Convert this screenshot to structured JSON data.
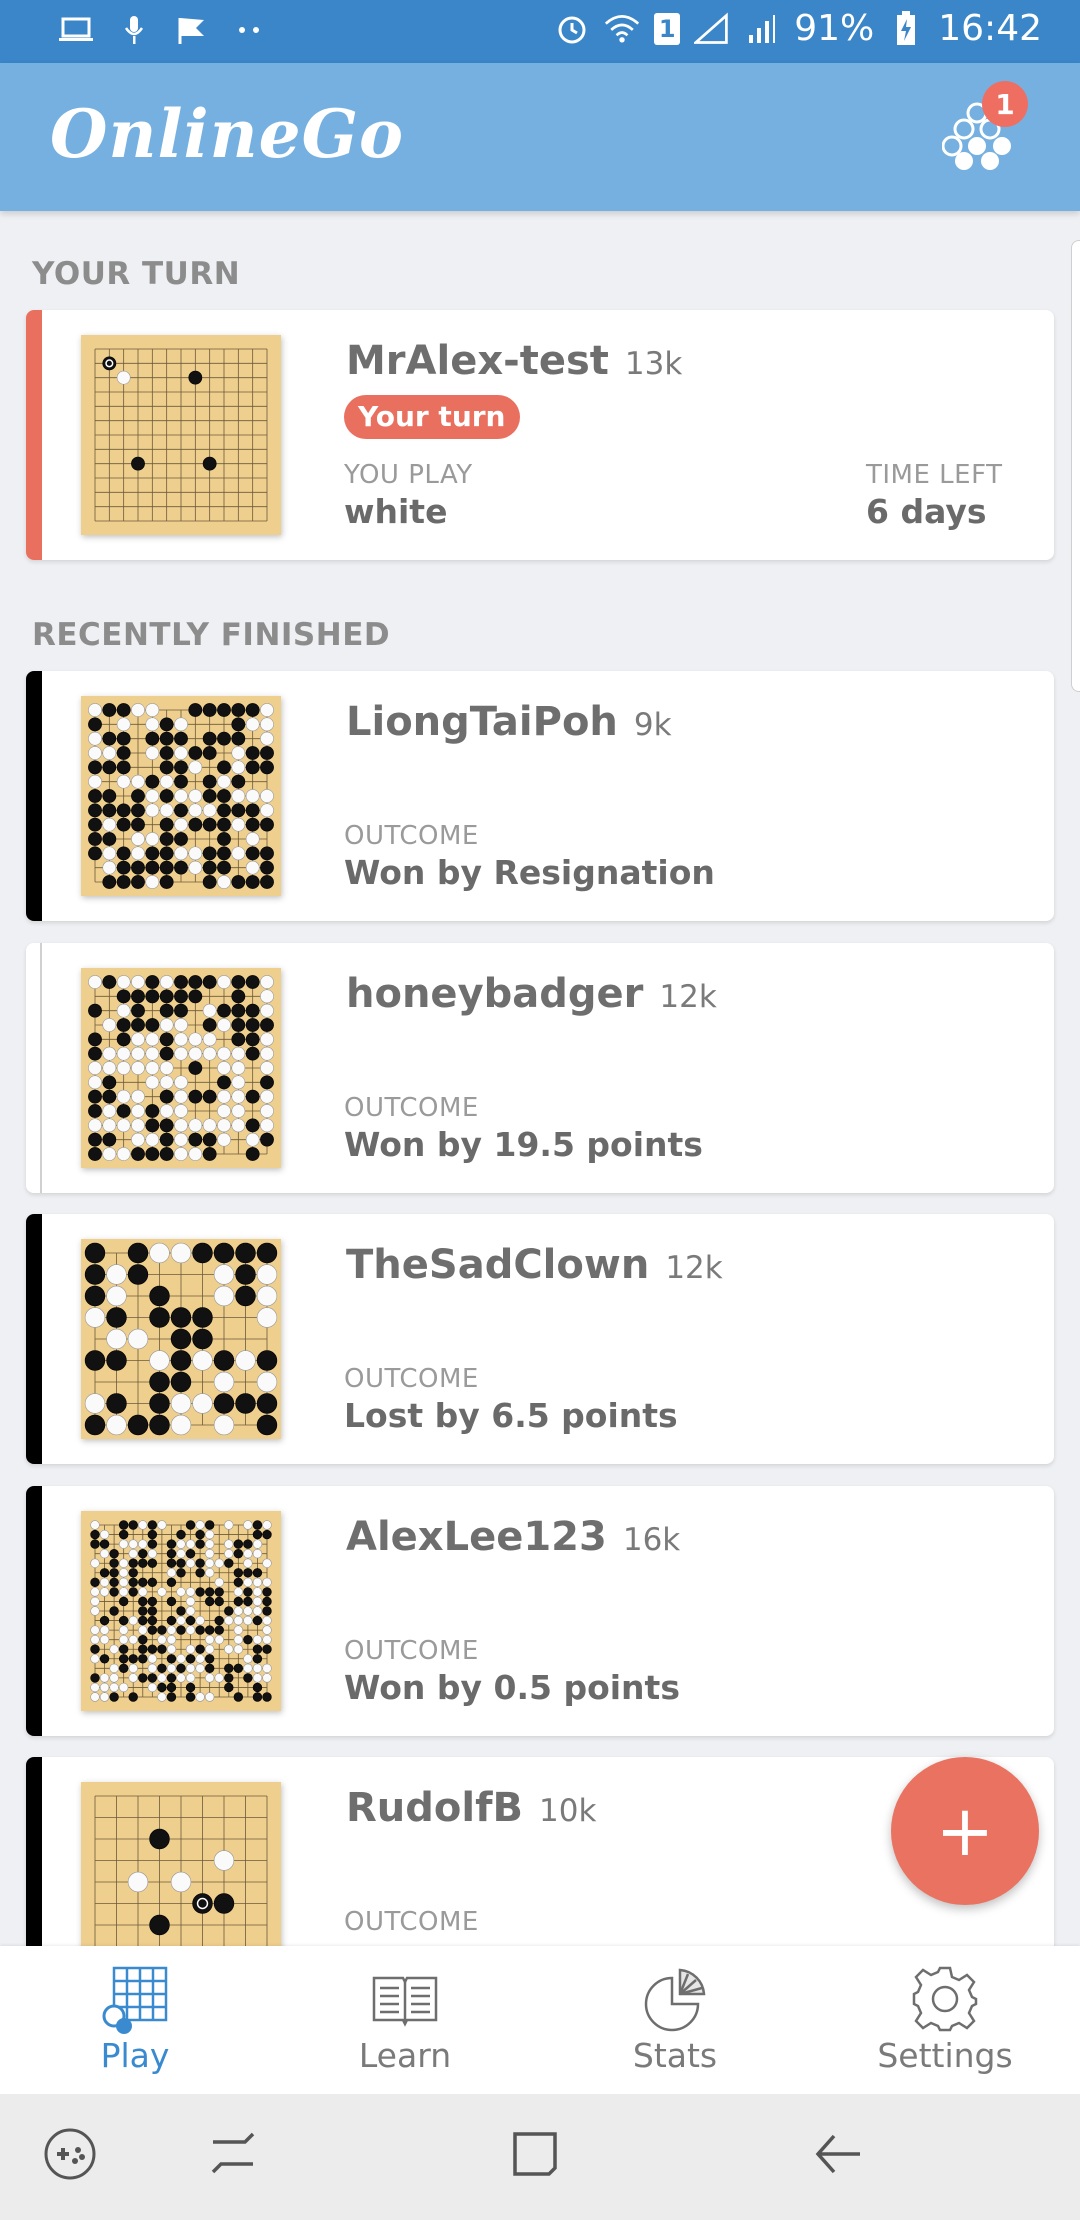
{
  "status_bar": {
    "battery": "91%",
    "time": "16:42",
    "sim_badge": "1"
  },
  "app": {
    "title": "OnlineGo",
    "notification_count": "1"
  },
  "sections": {
    "your_turn": "YOUR TURN",
    "recently_finished": "RECENTLY FINISHED"
  },
  "your_turn_game": {
    "opponent": "MrAlex-test",
    "rank": "13k",
    "badge": "Your turn",
    "you_play_label": "YOU PLAY",
    "you_play_value": "white",
    "time_left_label": "TIME LEFT",
    "time_left_value": "6 days",
    "stripe_color": "#e9705f"
  },
  "finished_games": [
    {
      "opponent": "LiongTaiPoh",
      "rank": "9k",
      "outcome_label": "OUTCOME",
      "outcome": "Won by Resignation",
      "stripe_color": "#000000"
    },
    {
      "opponent": "honeybadger",
      "rank": "12k",
      "outcome_label": "OUTCOME",
      "outcome": "Won by 19.5 points",
      "stripe_color": "#ffffff"
    },
    {
      "opponent": "TheSadClown",
      "rank": "12k",
      "outcome_label": "OUTCOME",
      "outcome": "Lost by 6.5 points",
      "stripe_color": "#000000"
    },
    {
      "opponent": "AlexLee123",
      "rank": "16k",
      "outcome_label": "OUTCOME",
      "outcome": "Won by 0.5 points",
      "stripe_color": "#000000"
    },
    {
      "opponent": "RudolfB",
      "rank": "10k",
      "outcome_label": "OUTCOME",
      "outcome": "",
      "stripe_color": "#000000"
    }
  ],
  "fab": {
    "label": "+"
  },
  "bottom_nav": [
    {
      "label": "Play",
      "icon": "grid-board-icon",
      "active": true
    },
    {
      "label": "Learn",
      "icon": "book-icon",
      "active": false
    },
    {
      "label": "Stats",
      "icon": "pie-chart-icon",
      "active": false
    },
    {
      "label": "Settings",
      "icon": "gear-icon",
      "active": false
    }
  ],
  "colors": {
    "status_bar": "#3a86c8",
    "app_bar": "#76b0e0",
    "accent": "#ea7260",
    "nav_active": "#3a8ad0"
  }
}
